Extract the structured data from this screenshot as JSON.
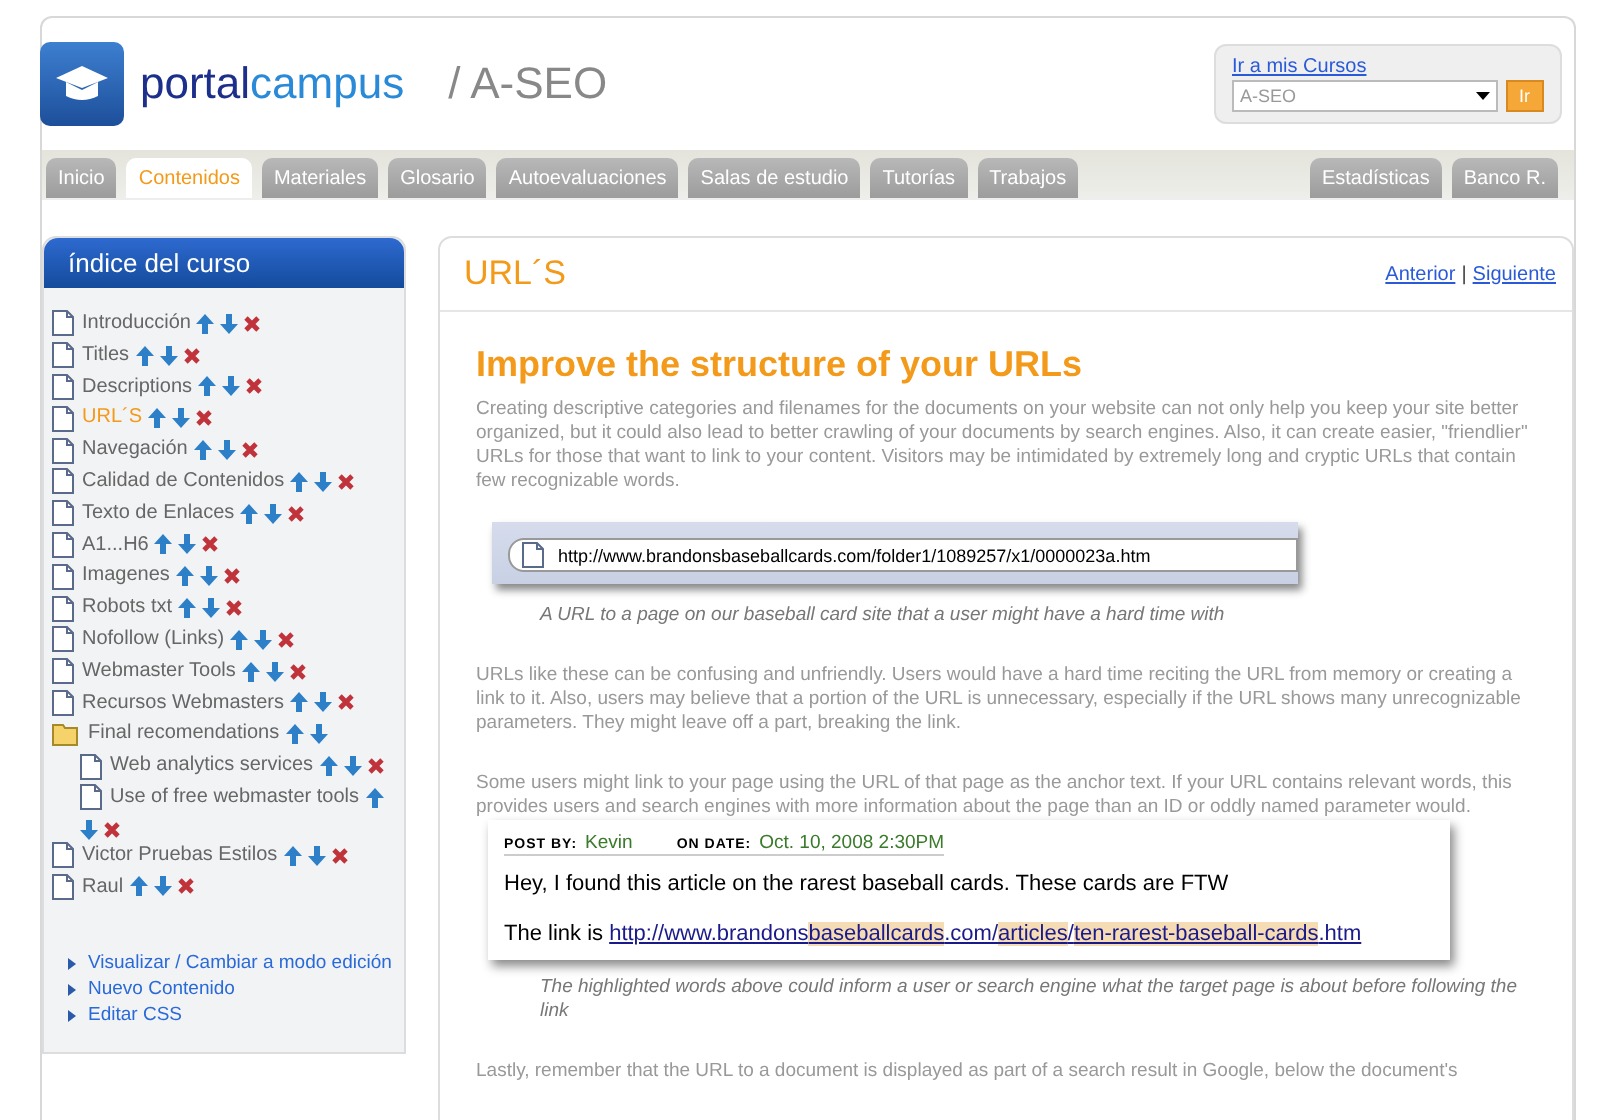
{
  "header": {
    "brand_first": "portal",
    "brand_second": "campus",
    "course_title": "/ A-SEO",
    "course_box": {
      "link": "Ir a mis Cursos",
      "select_value": "A-SEO",
      "button": "Ir"
    }
  },
  "tabs_left": [
    {
      "label": "Inicio",
      "selected": false
    },
    {
      "label": "Contenidos",
      "selected": true
    },
    {
      "label": "Materiales",
      "selected": false
    },
    {
      "label": "Glosario",
      "selected": false
    },
    {
      "label": "Autoevaluaciones",
      "selected": false
    },
    {
      "label": "Salas de estudio",
      "selected": false
    },
    {
      "label": "Tutorías",
      "selected": false
    },
    {
      "label": "Trabajos",
      "selected": false
    }
  ],
  "tabs_right": [
    {
      "label": "Estadísticas",
      "selected": false
    },
    {
      "label": "Banco R.",
      "selected": false
    }
  ],
  "sidebar": {
    "title": "índice del curso",
    "items": [
      {
        "kind": "doc",
        "label": "Introducción",
        "selected": false,
        "deletable": true
      },
      {
        "kind": "doc",
        "label": "Titles",
        "selected": false,
        "deletable": true
      },
      {
        "kind": "doc",
        "label": "Descriptions",
        "selected": false,
        "deletable": true
      },
      {
        "kind": "doc",
        "label": "URL´S",
        "selected": true,
        "deletable": true
      },
      {
        "kind": "doc",
        "label": "Navegación",
        "selected": false,
        "deletable": true
      },
      {
        "kind": "doc",
        "label": "Calidad de Contenidos",
        "selected": false,
        "deletable": true
      },
      {
        "kind": "doc",
        "label": "Texto de Enlaces",
        "selected": false,
        "deletable": true
      },
      {
        "kind": "doc",
        "label": "A1...H6",
        "selected": false,
        "deletable": true
      },
      {
        "kind": "doc",
        "label": "Imagenes",
        "selected": false,
        "deletable": true
      },
      {
        "kind": "doc",
        "label": "Robots txt",
        "selected": false,
        "deletable": true
      },
      {
        "kind": "doc",
        "label": "Nofollow (Links)",
        "selected": false,
        "deletable": true
      },
      {
        "kind": "doc",
        "label": "Webmaster Tools",
        "selected": false,
        "deletable": true
      },
      {
        "kind": "doc",
        "label": "Recursos Webmasters",
        "selected": false,
        "deletable": true
      },
      {
        "kind": "folder",
        "label": "Final recomendations",
        "selected": false,
        "deletable": false,
        "children": [
          {
            "kind": "doc",
            "label": "Web analytics services",
            "selected": false,
            "deletable": true
          },
          {
            "kind": "doc",
            "label": "Use of free webmaster tools",
            "selected": false,
            "deletable": true
          }
        ]
      },
      {
        "kind": "doc",
        "label": "Victor Pruebas Estilos",
        "selected": false,
        "deletable": true
      },
      {
        "kind": "doc",
        "label": "Raul",
        "selected": false,
        "deletable": true
      }
    ],
    "links": [
      "Visualizar / Cambiar a modo edición",
      "Nuevo Contenido",
      "Editar CSS"
    ]
  },
  "content": {
    "title": "URL´S",
    "nav": [
      "Anterior",
      "Siguiente"
    ],
    "nav_separator": "|",
    "heading": "Improve the structure of your URLs",
    "blocks": [
      {
        "kind": "paragraph",
        "text": "Creating descriptive categories and filenames for the documents on your website can not only help you keep your site better organized, but it could also lead to better crawling of your documents by search engines. Also, it can create easier, \"friendlier\" URLs for those that want to link to your content. Visitors may be intimidated by extremely long and cryptic URLs that contain few recognizable words."
      },
      {
        "kind": "address_bar",
        "url": "http://www.brandonsbaseballcards.com/folder1/1089257/x1/0000023a.htm"
      },
      {
        "kind": "caption",
        "text": "A URL to a page on our baseball card site that a user might have a hard time with"
      },
      {
        "kind": "paragraph",
        "text": "URLs like these can be confusing and unfriendly. Users would have a hard time reciting the URL from memory or creating a link to it. Also, users may believe that a portion of the URL is unnecessary, especially if the URL shows many unrecognizable parameters. They might leave off a part, breaking the link."
      },
      {
        "kind": "paragraph",
        "text": "Some users might link to your page using the URL of that page as the anchor text. If your URL contains relevant words, this provides users and search engines with more information about the page than an ID or oddly named parameter would."
      },
      {
        "kind": "post",
        "post_by_label": "POST BY:",
        "author": "Kevin",
        "date_label": "ON DATE:",
        "date": "Oct. 10, 2008 2:30PM",
        "message": "Hey, I found this article on the rarest baseball cards.  These cards are FTW",
        "link_intro": "The link is",
        "link_parts": [
          {
            "text": "http://www.brandons",
            "highlighted": false
          },
          {
            "text": "baseballcards",
            "highlighted": true
          },
          {
            "text": ".com/",
            "highlighted": false
          },
          {
            "text": "articles",
            "highlighted": true
          },
          {
            "text": "/",
            "highlighted": false
          },
          {
            "text": "ten-rarest-baseball-cards",
            "highlighted": true
          },
          {
            "text": ".htm",
            "highlighted": false
          }
        ]
      },
      {
        "kind": "caption",
        "text": "The highlighted words above could inform a user or search engine what the target page is about before following the link"
      },
      {
        "kind": "paragraph",
        "text": "Lastly, remember that the URL to a document is displayed as part of a search result in Google, below the document's"
      }
    ]
  }
}
